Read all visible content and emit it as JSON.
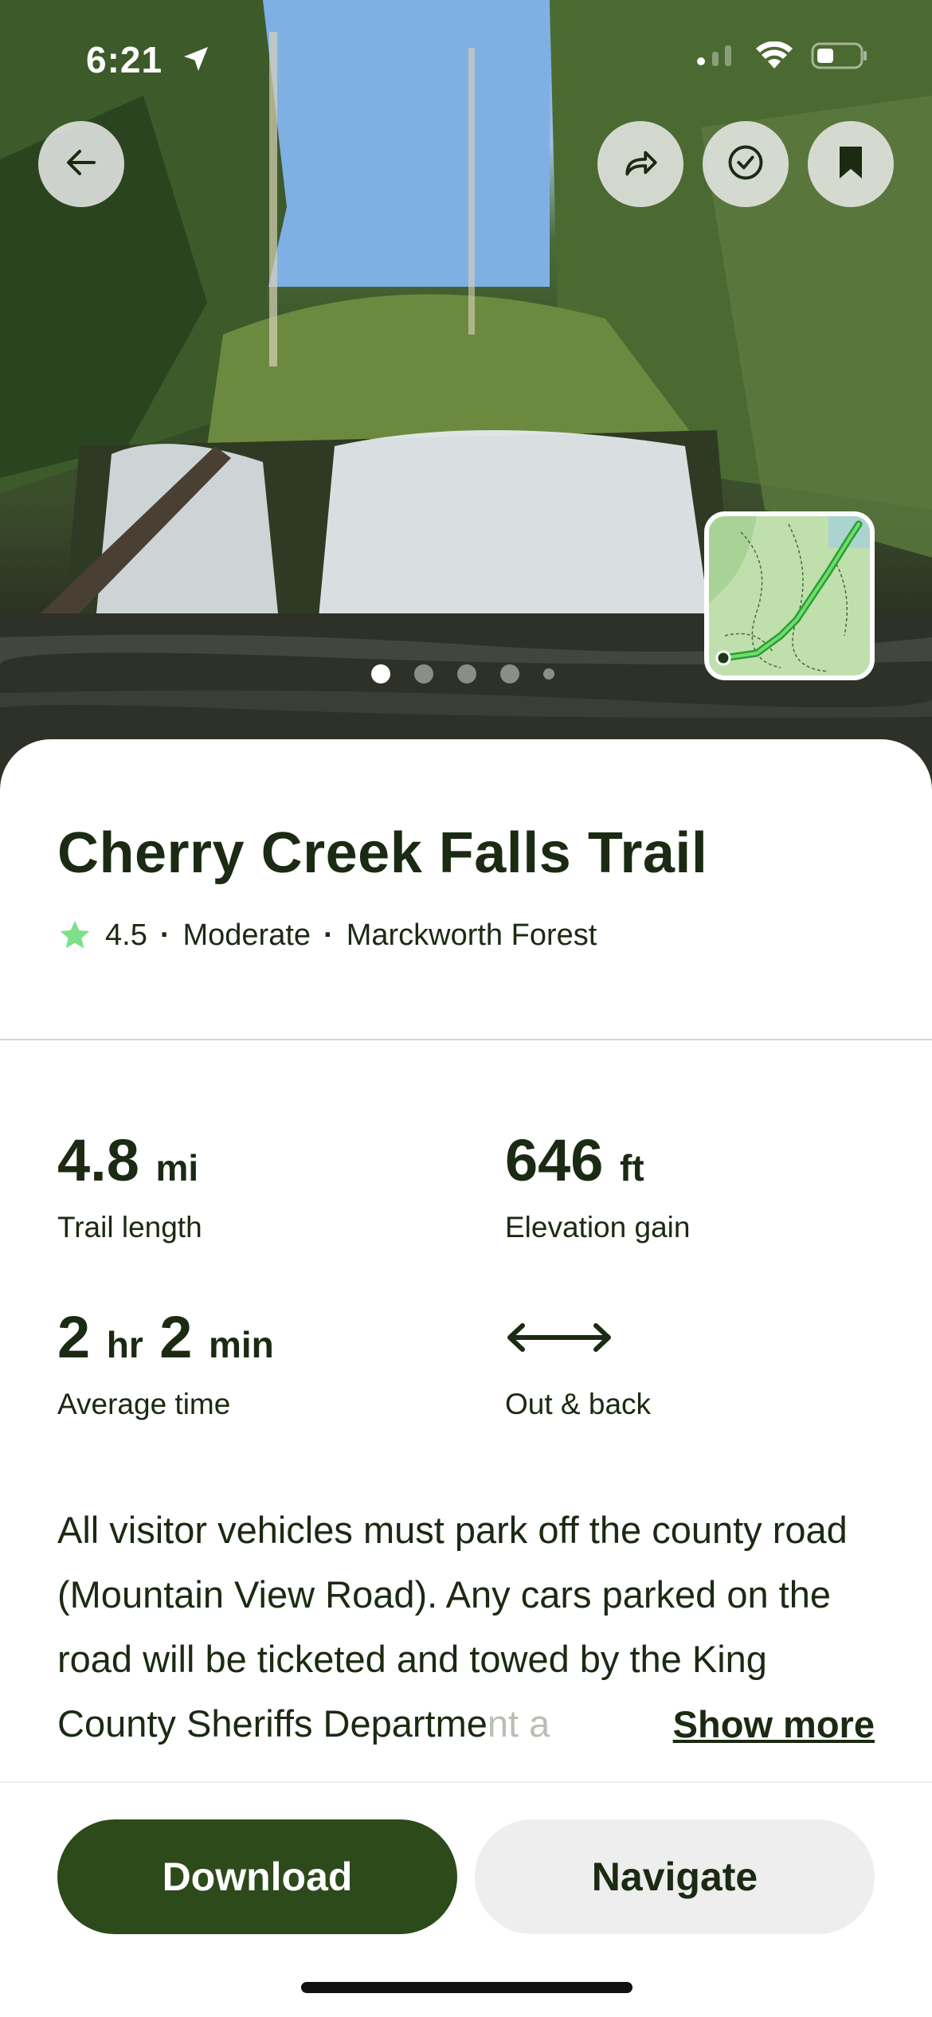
{
  "status_bar": {
    "time": "6:21"
  },
  "trail": {
    "name": "Cherry Creek Falls Trail",
    "rating": "4.5",
    "difficulty": "Moderate",
    "area": "Marckworth Forest"
  },
  "stats": {
    "length": {
      "value": "4.8",
      "unit": "mi",
      "label": "Trail length"
    },
    "elevation": {
      "value": "646",
      "unit": "ft",
      "label": "Elevation gain"
    },
    "time": {
      "hours": "2",
      "hours_unit": "hr",
      "minutes": "2",
      "minutes_unit": "min",
      "label": "Average time"
    },
    "route": {
      "label": "Out & back"
    }
  },
  "description": {
    "text": "All visitor vehicles must park off the county road (Mountain View Road). Any cars parked on the road will be ticketed and towed by the King County Sheriffs Departme",
    "faded_tail": "nt a",
    "show_more": "Show more"
  },
  "pager": {
    "count": 5,
    "active": 0
  },
  "actions": {
    "download": "Download",
    "navigate": "Navigate"
  },
  "icons": [
    "back-arrow-icon",
    "share-icon",
    "check-circle-icon",
    "bookmark-icon",
    "location-arrow-icon",
    "wifi-icon",
    "battery-icon",
    "star-icon",
    "out-and-back-arrow-icon"
  ],
  "colors": {
    "primary": "#2d4a1a",
    "star": "#7ee08a",
    "text": "#1b2a12"
  }
}
